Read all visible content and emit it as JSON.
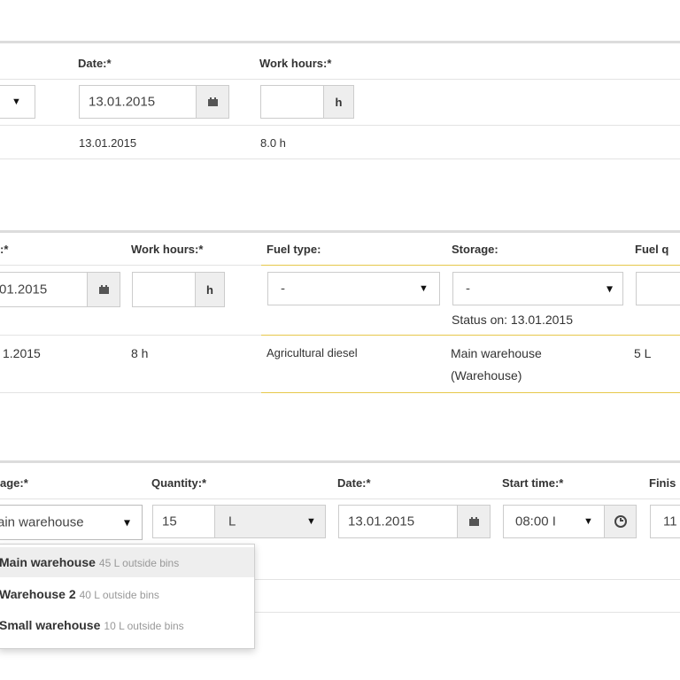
{
  "section1": {
    "headers": {
      "date": "Date:*",
      "work_hours": "Work hours:*"
    },
    "date_input": "13.01.2015",
    "hours_input": "",
    "hours_unit": "h",
    "row": {
      "date": "13.01.2015",
      "hours": "8.0 h"
    }
  },
  "section2": {
    "headers": {
      "date_partial": ":*",
      "work_hours": "Work hours:*",
      "fuel_type": "Fuel type:",
      "storage": "Storage:",
      "fuel_q_partial": "Fuel q"
    },
    "date_input": "01.2015",
    "hours_input": "",
    "hours_unit": "h",
    "fuel_type_select": "-",
    "storage_select": "-",
    "status_text": "Status on: 13.01.2015",
    "row": {
      "date": "1.2015",
      "hours": "8 h",
      "fuel_type": "Agricultural diesel",
      "storage_line1": "Main warehouse",
      "storage_line2": "(Warehouse)",
      "quantity": "5 L"
    }
  },
  "section3": {
    "headers": {
      "storage_partial": "age:*",
      "quantity": "Quantity:*",
      "date": "Date:*",
      "start_time": "Start time:*",
      "finish_partial": "Finis"
    },
    "storage_select": "ain warehouse",
    "quantity_input": "15",
    "unit_select": "L",
    "date_input": "13.01.2015",
    "start_time_input": "08:00 I",
    "finish_input_partial": "11"
  },
  "storage_dropdown": {
    "items": [
      {
        "name": "Main warehouse",
        "extra": "45 L outside bins"
      },
      {
        "name": "Warehouse 2",
        "extra": "40 L outside bins"
      },
      {
        "name": "Small warehouse",
        "extra": "10 L outside bins"
      }
    ]
  },
  "icons": {
    "caret": "▼",
    "small_caret": "▾",
    "calendar": "calendar-icon",
    "clock": "clock-icon"
  }
}
